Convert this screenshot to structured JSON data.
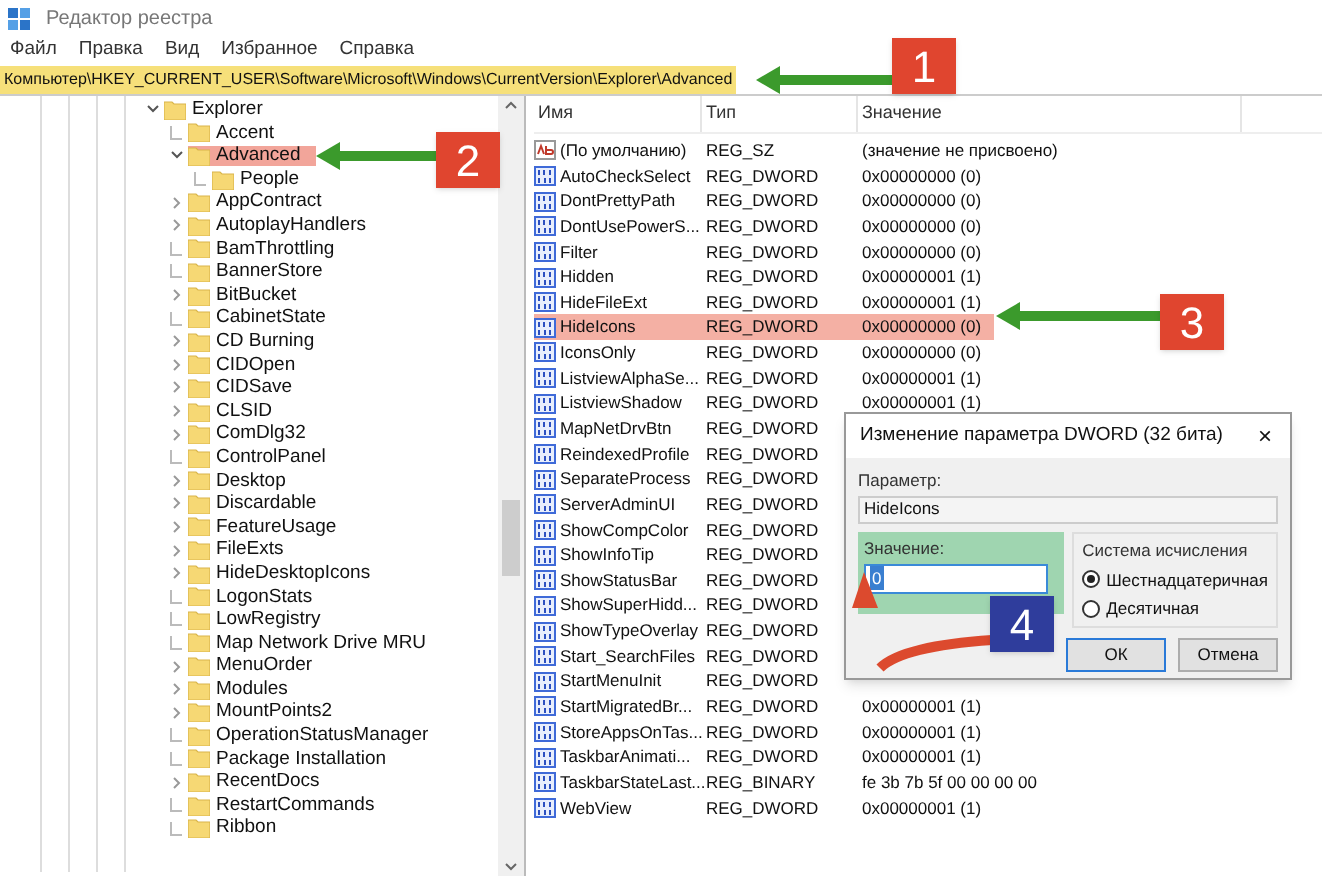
{
  "window": {
    "title": "Редактор реестра"
  },
  "menu": [
    "Файл",
    "Правка",
    "Вид",
    "Избранное",
    "Справка"
  ],
  "address": {
    "path": "Компьютер\\HKEY_CURRENT_USER\\Software\\Microsoft\\Windows\\CurrentVersion\\Explorer\\Advanced",
    "highlighted": true
  },
  "tree": [
    {
      "label": "Explorer",
      "kind": "branch",
      "expanded": true,
      "highlighted": false,
      "children": [
        {
          "label": "Accent",
          "kind": "leaf",
          "highlighted": false
        },
        {
          "label": "Advanced",
          "kind": "branch",
          "expanded": true,
          "highlighted": true,
          "children": [
            {
              "label": "People",
              "kind": "leaf",
              "highlighted": false
            }
          ]
        },
        {
          "label": "AppContract",
          "kind": "branch",
          "expanded": false,
          "highlighted": false
        },
        {
          "label": "AutoplayHandlers",
          "kind": "branch",
          "expanded": false,
          "highlighted": false
        },
        {
          "label": "BamThrottling",
          "kind": "leaf",
          "highlighted": false
        },
        {
          "label": "BannerStore",
          "kind": "leaf",
          "highlighted": false
        },
        {
          "label": "BitBucket",
          "kind": "branch",
          "expanded": false,
          "highlighted": false
        },
        {
          "label": "CabinetState",
          "kind": "leaf",
          "highlighted": false
        },
        {
          "label": "CD Burning",
          "kind": "branch",
          "expanded": false,
          "highlighted": false
        },
        {
          "label": "CIDOpen",
          "kind": "branch",
          "expanded": false,
          "highlighted": false
        },
        {
          "label": "CIDSave",
          "kind": "branch",
          "expanded": false,
          "highlighted": false
        },
        {
          "label": "CLSID",
          "kind": "branch",
          "expanded": false,
          "highlighted": false
        },
        {
          "label": "ComDlg32",
          "kind": "branch",
          "expanded": false,
          "highlighted": false
        },
        {
          "label": "ControlPanel",
          "kind": "leaf",
          "highlighted": false
        },
        {
          "label": "Desktop",
          "kind": "branch",
          "expanded": false,
          "highlighted": false
        },
        {
          "label": "Discardable",
          "kind": "branch",
          "expanded": false,
          "highlighted": false
        },
        {
          "label": "FeatureUsage",
          "kind": "branch",
          "expanded": false,
          "highlighted": false
        },
        {
          "label": "FileExts",
          "kind": "branch",
          "expanded": false,
          "highlighted": false
        },
        {
          "label": "HideDesktopIcons",
          "kind": "branch",
          "expanded": false,
          "highlighted": false
        },
        {
          "label": "LogonStats",
          "kind": "leaf",
          "highlighted": false
        },
        {
          "label": "LowRegistry",
          "kind": "leaf",
          "highlighted": false
        },
        {
          "label": "Map Network Drive MRU",
          "kind": "leaf",
          "highlighted": false
        },
        {
          "label": "MenuOrder",
          "kind": "branch",
          "expanded": false,
          "highlighted": false
        },
        {
          "label": "Modules",
          "kind": "branch",
          "expanded": false,
          "highlighted": false
        },
        {
          "label": "MountPoints2",
          "kind": "branch",
          "expanded": false,
          "highlighted": false
        },
        {
          "label": "OperationStatusManager",
          "kind": "leaf",
          "highlighted": false
        },
        {
          "label": "Package Installation",
          "kind": "leaf",
          "highlighted": false
        },
        {
          "label": "RecentDocs",
          "kind": "branch",
          "expanded": false,
          "highlighted": false
        },
        {
          "label": "RestartCommands",
          "kind": "leaf",
          "highlighted": false
        },
        {
          "label": "Ribbon",
          "kind": "leaf",
          "highlighted": false
        }
      ]
    }
  ],
  "table": {
    "columns": [
      "Имя",
      "Тип",
      "Значение"
    ],
    "rows": [
      {
        "kind": "string",
        "name": "(По умолчанию)",
        "type": "REG_SZ",
        "value": "(значение не присвоено)",
        "highlighted": false
      },
      {
        "kind": "binary",
        "name": "AutoCheckSelect",
        "type": "REG_DWORD",
        "value": "0x00000000 (0)",
        "highlighted": false
      },
      {
        "kind": "binary",
        "name": "DontPrettyPath",
        "type": "REG_DWORD",
        "value": "0x00000000 (0)",
        "highlighted": false
      },
      {
        "kind": "binary",
        "name": "DontUsePowerS...",
        "type": "REG_DWORD",
        "value": "0x00000000 (0)",
        "highlighted": false
      },
      {
        "kind": "binary",
        "name": "Filter",
        "type": "REG_DWORD",
        "value": "0x00000000 (0)",
        "highlighted": false
      },
      {
        "kind": "binary",
        "name": "Hidden",
        "type": "REG_DWORD",
        "value": "0x00000001 (1)",
        "highlighted": false
      },
      {
        "kind": "binary",
        "name": "HideFileExt",
        "type": "REG_DWORD",
        "value": "0x00000001 (1)",
        "highlighted": false
      },
      {
        "kind": "binary",
        "name": "HideIcons",
        "type": "REG_DWORD",
        "value": "0x00000000 (0)",
        "highlighted": true
      },
      {
        "kind": "binary",
        "name": "IconsOnly",
        "type": "REG_DWORD",
        "value": "0x00000000 (0)",
        "highlighted": false
      },
      {
        "kind": "binary",
        "name": "ListviewAlphaSe...",
        "type": "REG_DWORD",
        "value": "0x00000001 (1)",
        "highlighted": false
      },
      {
        "kind": "binary",
        "name": "ListviewShadow",
        "type": "REG_DWORD",
        "value": "0x00000001 (1)",
        "highlighted": false
      },
      {
        "kind": "binary",
        "name": "MapNetDrvBtn",
        "type": "REG_DWORD",
        "highlighted": false
      },
      {
        "kind": "binary",
        "name": "ReindexedProfile",
        "type": "REG_DWORD",
        "highlighted": false
      },
      {
        "kind": "binary",
        "name": "SeparateProcess",
        "type": "REG_DWORD",
        "highlighted": false
      },
      {
        "kind": "binary",
        "name": "ServerAdminUI",
        "type": "REG_DWORD",
        "highlighted": false
      },
      {
        "kind": "binary",
        "name": "ShowCompColor",
        "type": "REG_DWORD",
        "highlighted": false
      },
      {
        "kind": "binary",
        "name": "ShowInfoTip",
        "type": "REG_DWORD",
        "highlighted": false
      },
      {
        "kind": "binary",
        "name": "ShowStatusBar",
        "type": "REG_DWORD",
        "highlighted": false
      },
      {
        "kind": "binary",
        "name": "ShowSuperHidd...",
        "type": "REG_DWORD",
        "highlighted": false
      },
      {
        "kind": "binary",
        "name": "ShowTypeOverlay",
        "type": "REG_DWORD",
        "highlighted": false
      },
      {
        "kind": "binary",
        "name": "Start_SearchFiles",
        "type": "REG_DWORD",
        "highlighted": false
      },
      {
        "kind": "binary",
        "name": "StartMenuInit",
        "type": "REG_DWORD",
        "highlighted": false
      },
      {
        "kind": "binary",
        "name": "StartMigratedBr...",
        "type": "REG_DWORD",
        "value": "0x00000001 (1)",
        "highlighted": false
      },
      {
        "kind": "binary",
        "name": "StoreAppsOnTas...",
        "type": "REG_DWORD",
        "value": "0x00000001 (1)",
        "highlighted": false
      },
      {
        "kind": "binary",
        "name": "TaskbarAnimati...",
        "type": "REG_DWORD",
        "value": "0x00000001 (1)",
        "highlighted": false
      },
      {
        "kind": "binary",
        "name": "TaskbarStateLast...",
        "type": "REG_BINARY",
        "value": "fe 3b 7b 5f 00 00 00 00",
        "highlighted": false
      },
      {
        "kind": "binary",
        "name": "WebView",
        "type": "REG_DWORD",
        "value": "0x00000001 (1)",
        "highlighted": false
      }
    ]
  },
  "dialog": {
    "title": "Изменение параметра DWORD (32 бита)",
    "close": "×",
    "param_label": "Параметр:",
    "param_value": "HideIcons",
    "value_label": "Значение:",
    "value": "0",
    "value_highlighted": true,
    "group_label": "Система исчисления",
    "radios": [
      {
        "label": "Шестнадцатеричная",
        "selected": true
      },
      {
        "label": "Десятичная",
        "selected": false
      }
    ],
    "buttons": [
      {
        "label": "ОК",
        "default": true
      },
      {
        "label": "Отмена",
        "default": false
      }
    ]
  },
  "annotations": [
    {
      "number": "1",
      "color": "#e0452f",
      "arrow": {
        "color": "#3b9a2c"
      }
    },
    {
      "number": "2",
      "color": "#e0452f",
      "arrow": {
        "color": "#3b9a2c"
      }
    },
    {
      "number": "3",
      "color": "#e0452f",
      "arrow": {
        "color": "#3b9a2c"
      }
    },
    {
      "number": "4",
      "color": "#2f3d9c",
      "arrow": {
        "color": "#dc4a2e"
      }
    }
  ]
}
